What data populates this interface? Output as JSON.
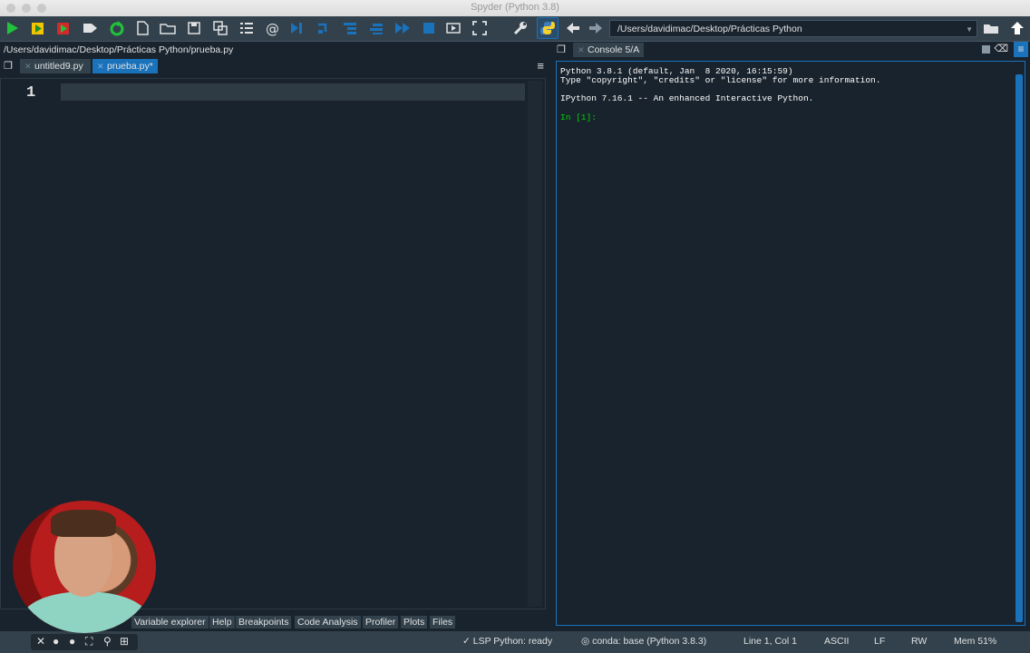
{
  "window": {
    "title": "Spyder (Python 3.8)"
  },
  "toolbar": {
    "path": "/Users/davidimac/Desktop/Prácticas Python"
  },
  "editor": {
    "file_path": "/Users/davidimac/Desktop/Prácticas Python/prueba.py",
    "tabs": [
      {
        "label": "untitled9.py"
      },
      {
        "label": "prueba.py*"
      }
    ],
    "line_numbers": [
      "1"
    ]
  },
  "bottom_tabs": [
    "Variable explorer",
    "Help",
    "Breakpoints",
    "Code Analysis",
    "Profiler",
    "Plots",
    "Files"
  ],
  "console": {
    "tab_label": "Console 5/A",
    "lines": [
      "Python 3.8.1 (default, Jan  8 2020, 16:15:59)",
      "Type \"copyright\", \"credits\" or \"license\" for more information.",
      "IPython 7.16.1 -- An enhanced Interactive Python."
    ],
    "prompt": "In [1]:"
  },
  "status_bar": {
    "lsp": "LSP Python: ready",
    "conda": "conda: base (Python 3.8.3)",
    "position": "Line 1, Col 1",
    "encoding": "ASCII",
    "eol": "LF",
    "permissions": "RW",
    "memory": "Mem 51%"
  },
  "colors": {
    "background": "#19232d",
    "toolbar": "#32414b",
    "accent": "#1a72bb",
    "prompt": "#00d300"
  }
}
